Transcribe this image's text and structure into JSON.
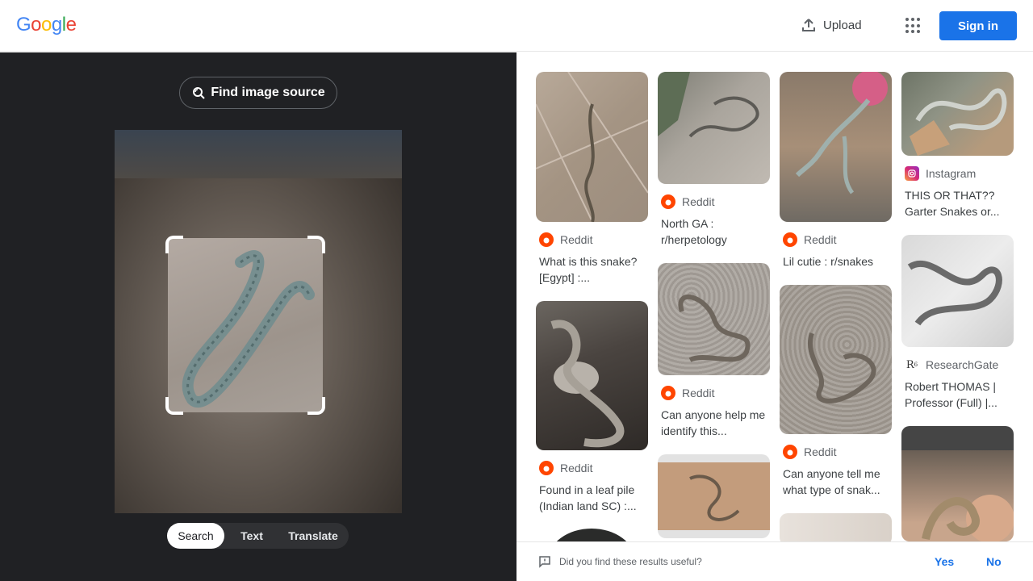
{
  "header": {
    "logo": [
      "G",
      "o",
      "o",
      "g",
      "l",
      "e"
    ],
    "logo_colors": [
      "#4285F4",
      "#EA4335",
      "#FBBC05",
      "#4285F4",
      "#34A853",
      "#EA4335"
    ],
    "upload_label": "Upload",
    "signin_label": "Sign in"
  },
  "lens": {
    "find_source_label": "Find image source",
    "modes": [
      "Search",
      "Text",
      "Translate"
    ],
    "active_mode": "Search"
  },
  "results": [
    {
      "source": "Reddit",
      "icon": "reddit-icon",
      "title": "What is this snake? [Egypt] :..."
    },
    {
      "source": "Reddit",
      "icon": "reddit-icon",
      "title": "Found in a leaf pile (Indian land SC) :..."
    },
    {
      "source": "Reddit",
      "icon": "reddit-icon",
      "title": "North GA : r/herpetology"
    },
    {
      "source": "Reddit",
      "icon": "reddit-icon",
      "title": "Can anyone help me identify this..."
    },
    {
      "source": "Reddit",
      "icon": "reddit-icon",
      "title": "Lil cutie : r/snakes"
    },
    {
      "source": "Reddit",
      "icon": "reddit-icon",
      "title": "Can anyone tell me what type of snak..."
    },
    {
      "source": "Instagram",
      "icon": "instagram-icon",
      "title": "THIS OR THAT?? Garter Snakes or..."
    },
    {
      "source": "ResearchGate",
      "icon": "researchgate-icon",
      "title": "Robert THOMAS | Professor (Full) |..."
    }
  ],
  "footer": {
    "question": "Did you find these results useful?",
    "yes_label": "Yes",
    "no_label": "No"
  },
  "colors": {
    "accent": "#1a73e8",
    "dark_panel": "#202124",
    "reddit": "#ff4500"
  }
}
